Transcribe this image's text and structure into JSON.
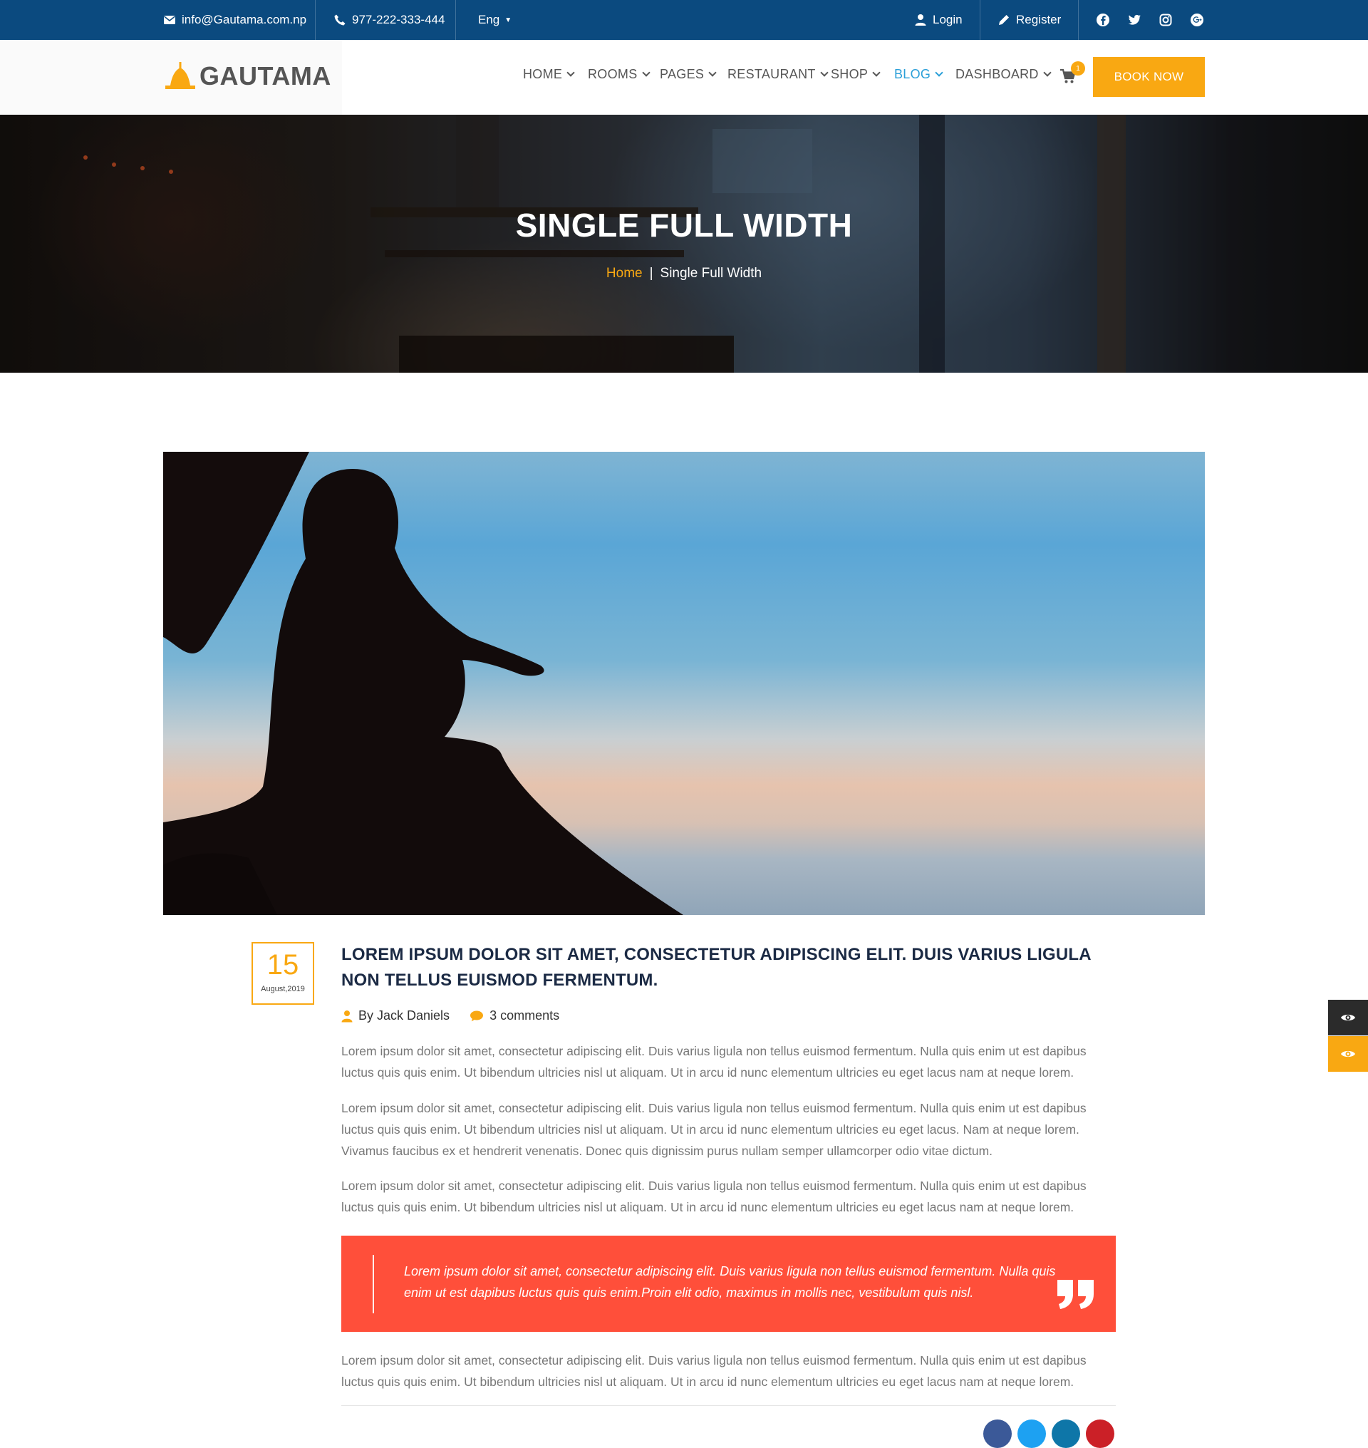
{
  "topbar": {
    "email": "info@Gautama.com.np",
    "phone": "977-222-333-444",
    "language": "Eng",
    "login": "Login",
    "register": "Register",
    "socials": [
      "facebook-icon",
      "twitter-icon",
      "instagram-icon",
      "google-plus-icon"
    ]
  },
  "header": {
    "logo_text": "GAUTAMA",
    "nav": [
      {
        "label": "HOME",
        "active": false
      },
      {
        "label": "ROOMS",
        "active": false
      },
      {
        "label": "PAGES",
        "active": false
      },
      {
        "label": "RESTAURANT",
        "active": false
      },
      {
        "label": "SHOP",
        "active": false
      },
      {
        "label": "BLOG",
        "active": true
      },
      {
        "label": "DASHBOARD",
        "active": false
      }
    ],
    "cart_count": "1",
    "book_now": "BOOK NOW"
  },
  "hero": {
    "title": "SINGLE FULL WIDTH",
    "breadcrumb_home": "Home",
    "breadcrumb_sep": "|",
    "breadcrumb_current": "Single Full Width"
  },
  "post": {
    "date_day": "15",
    "date_month_year": "August,2019",
    "title": "LOREM IPSUM DOLOR SIT AMET, CONSECTETUR ADIPISCING ELIT. DUIS VARIUS LIGULA NON TELLUS EUISMOD FERMENTUM.",
    "author": "By Jack Daniels",
    "comments": "3 comments",
    "paragraphs": [
      "Lorem ipsum dolor sit amet, consectetur adipiscing elit. Duis varius ligula non tellus euismod fermentum. Nulla quis enim ut est dapibus luctus quis quis enim. Ut bibendum ultricies nisl ut aliquam. Ut in arcu id nunc elementum ultricies eu eget lacus nam at neque lorem.",
      "Lorem ipsum dolor sit amet, consectetur adipiscing elit. Duis varius ligula non tellus euismod fermentum. Nulla quis enim ut est dapibus luctus quis quis enim. Ut bibendum ultricies nisl ut aliquam. Ut in arcu id nunc elementum ultricies eu eget lacus. Nam at neque lorem. Vivamus faucibus ex et hendrerit venenatis. Donec quis dignissim purus nullam semper ullamcorper odio vitae dictum.",
      "Lorem ipsum dolor sit amet, consectetur adipiscing elit. Duis varius ligula non tellus euismod fermentum. Nulla quis enim ut est dapibus luctus quis quis enim. Ut bibendum ultricies nisl ut aliquam. Ut in arcu id nunc elementum ultricies eu eget lacus nam at neque lorem."
    ],
    "quote": "Lorem ipsum dolor sit amet, consectetur adipiscing elit. Duis varius ligula non tellus euismod fermentum. Nulla quis enim ut est dapibus luctus quis quis enim.Proin elit odio, maximus in mollis nec, vestibulum quis nisl.",
    "closing_paragraph": "Lorem ipsum dolor sit amet, consectetur adipiscing elit. Duis varius ligula non tellus euismod fermentum. Nulla quis enim ut est dapibus luctus quis quis enim. Ut bibendum ultricies nisl ut aliquam. Ut in arcu id nunc elementum ultricies eu eget lacus nam at neque lorem."
  },
  "colors": {
    "topbar": "#0b4a7f",
    "accent": "#f9a812",
    "nav_active": "#2a9fd8",
    "quote_bg": "#ff4f3a",
    "title_dark": "#1b2a44"
  },
  "side_tabs": [
    "eye-icon",
    "eye-icon"
  ]
}
